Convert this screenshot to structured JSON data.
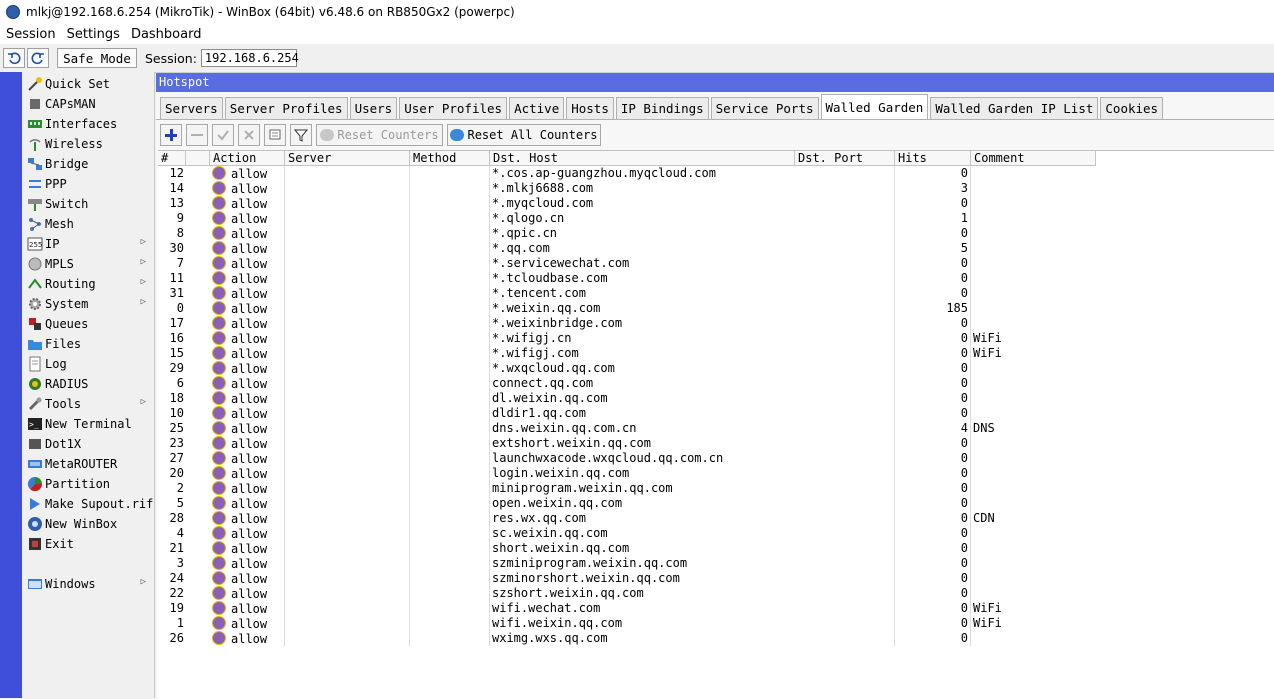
{
  "window": {
    "title": "mlkj@192.168.6.254 (MikroTik) - WinBox (64bit) v6.48.6 on RB850Gx2 (powerpc)"
  },
  "menu": [
    "Session",
    "Settings",
    "Dashboard"
  ],
  "toolbar": {
    "safe_mode": "Safe Mode",
    "session_label": "Session:",
    "session_value": "192.168.6.254"
  },
  "sidebar": {
    "items": [
      {
        "label": "Quick Set",
        "icon": "wand-icon",
        "arrow": false
      },
      {
        "label": "CAPsMAN",
        "icon": "caps-icon",
        "arrow": false
      },
      {
        "label": "Interfaces",
        "icon": "interfaces-icon",
        "arrow": false
      },
      {
        "label": "Wireless",
        "icon": "wireless-icon",
        "arrow": false
      },
      {
        "label": "Bridge",
        "icon": "bridge-icon",
        "arrow": false
      },
      {
        "label": "PPP",
        "icon": "ppp-icon",
        "arrow": false
      },
      {
        "label": "Switch",
        "icon": "switch-icon",
        "arrow": false
      },
      {
        "label": "Mesh",
        "icon": "mesh-icon",
        "arrow": false
      },
      {
        "label": "IP",
        "icon": "ip-icon",
        "arrow": true
      },
      {
        "label": "MPLS",
        "icon": "mpls-icon",
        "arrow": true
      },
      {
        "label": "Routing",
        "icon": "routing-icon",
        "arrow": true
      },
      {
        "label": "System",
        "icon": "system-icon",
        "arrow": true
      },
      {
        "label": "Queues",
        "icon": "queues-icon",
        "arrow": false
      },
      {
        "label": "Files",
        "icon": "files-icon",
        "arrow": false
      },
      {
        "label": "Log",
        "icon": "log-icon",
        "arrow": false
      },
      {
        "label": "RADIUS",
        "icon": "radius-icon",
        "arrow": false
      },
      {
        "label": "Tools",
        "icon": "tools-icon",
        "arrow": true
      },
      {
        "label": "New Terminal",
        "icon": "terminal-icon",
        "arrow": false
      },
      {
        "label": "Dot1X",
        "icon": "dot1x-icon",
        "arrow": false
      },
      {
        "label": "MetaROUTER",
        "icon": "metarouter-icon",
        "arrow": false
      },
      {
        "label": "Partition",
        "icon": "partition-icon",
        "arrow": false
      },
      {
        "label": "Make Supout.rif",
        "icon": "supout-icon",
        "arrow": false
      },
      {
        "label": "New WinBox",
        "icon": "winbox-icon",
        "arrow": false
      },
      {
        "label": "Exit",
        "icon": "exit-icon",
        "arrow": false
      }
    ],
    "windows": {
      "label": "Windows",
      "icon": "windows-icon"
    }
  },
  "hotspot": {
    "title": "Hotspot",
    "tabs": [
      "Servers",
      "Server Profiles",
      "Users",
      "User Profiles",
      "Active",
      "Hosts",
      "IP Bindings",
      "Service Ports",
      "Walled Garden",
      "Walled Garden IP List",
      "Cookies"
    ],
    "active_tab": "Walled Garden",
    "reset_counters": "Reset Counters",
    "reset_all_counters": "Reset All Counters"
  },
  "table": {
    "columns": [
      "#",
      "Action",
      "Server",
      "Method",
      "Dst. Host",
      "Dst. Port",
      "Hits",
      "Comment"
    ],
    "rows": [
      {
        "id": "12",
        "action": "allow",
        "server": "",
        "method": "",
        "host": "*.cos.ap-guangzhou.myqcloud.com",
        "port": "",
        "hits": "0",
        "comment": ""
      },
      {
        "id": "14",
        "action": "allow",
        "server": "",
        "method": "",
        "host": "*.mlkj6688.com",
        "port": "",
        "hits": "3",
        "comment": ""
      },
      {
        "id": "13",
        "action": "allow",
        "server": "",
        "method": "",
        "host": "*.myqcloud.com",
        "port": "",
        "hits": "0",
        "comment": ""
      },
      {
        "id": "9",
        "action": "allow",
        "server": "",
        "method": "",
        "host": "*.qlogo.cn",
        "port": "",
        "hits": "1",
        "comment": ""
      },
      {
        "id": "8",
        "action": "allow",
        "server": "",
        "method": "",
        "host": "*.qpic.cn",
        "port": "",
        "hits": "0",
        "comment": ""
      },
      {
        "id": "30",
        "action": "allow",
        "server": "",
        "method": "",
        "host": "*.qq.com",
        "port": "",
        "hits": "5",
        "comment": ""
      },
      {
        "id": "7",
        "action": "allow",
        "server": "",
        "method": "",
        "host": "*.servicewechat.com",
        "port": "",
        "hits": "0",
        "comment": ""
      },
      {
        "id": "11",
        "action": "allow",
        "server": "",
        "method": "",
        "host": "*.tcloudbase.com",
        "port": "",
        "hits": "0",
        "comment": ""
      },
      {
        "id": "31",
        "action": "allow",
        "server": "",
        "method": "",
        "host": "*.tencent.com",
        "port": "",
        "hits": "0",
        "comment": ""
      },
      {
        "id": "0",
        "action": "allow",
        "server": "",
        "method": "",
        "host": "*.weixin.qq.com",
        "port": "",
        "hits": "185",
        "comment": ""
      },
      {
        "id": "17",
        "action": "allow",
        "server": "",
        "method": "",
        "host": "*.weixinbridge.com",
        "port": "",
        "hits": "0",
        "comment": ""
      },
      {
        "id": "16",
        "action": "allow",
        "server": "",
        "method": "",
        "host": "*.wifigj.cn",
        "port": "",
        "hits": "0",
        "comment": "WiFi"
      },
      {
        "id": "15",
        "action": "allow",
        "server": "",
        "method": "",
        "host": "*.wifigj.com",
        "port": "",
        "hits": "0",
        "comment": "WiFi"
      },
      {
        "id": "29",
        "action": "allow",
        "server": "",
        "method": "",
        "host": "*.wxqcloud.qq.com",
        "port": "",
        "hits": "0",
        "comment": ""
      },
      {
        "id": "6",
        "action": "allow",
        "server": "",
        "method": "",
        "host": "connect.qq.com",
        "port": "",
        "hits": "0",
        "comment": ""
      },
      {
        "id": "18",
        "action": "allow",
        "server": "",
        "method": "",
        "host": "dl.weixin.qq.com",
        "port": "",
        "hits": "0",
        "comment": ""
      },
      {
        "id": "10",
        "action": "allow",
        "server": "",
        "method": "",
        "host": "dldir1.qq.com",
        "port": "",
        "hits": "0",
        "comment": ""
      },
      {
        "id": "25",
        "action": "allow",
        "server": "",
        "method": "",
        "host": "dns.weixin.qq.com.cn",
        "port": "",
        "hits": "4",
        "comment": "DNS"
      },
      {
        "id": "23",
        "action": "allow",
        "server": "",
        "method": "",
        "host": "extshort.weixin.qq.com",
        "port": "",
        "hits": "0",
        "comment": ""
      },
      {
        "id": "27",
        "action": "allow",
        "server": "",
        "method": "",
        "host": "launchwxacode.wxqcloud.qq.com.cn",
        "port": "",
        "hits": "0",
        "comment": ""
      },
      {
        "id": "20",
        "action": "allow",
        "server": "",
        "method": "",
        "host": "login.weixin.qq.com",
        "port": "",
        "hits": "0",
        "comment": ""
      },
      {
        "id": "2",
        "action": "allow",
        "server": "",
        "method": "",
        "host": "miniprogram.weixin.qq.com",
        "port": "",
        "hits": "0",
        "comment": ""
      },
      {
        "id": "5",
        "action": "allow",
        "server": "",
        "method": "",
        "host": "open.weixin.qq.com",
        "port": "",
        "hits": "0",
        "comment": ""
      },
      {
        "id": "28",
        "action": "allow",
        "server": "",
        "method": "",
        "host": "res.wx.qq.com",
        "port": "",
        "hits": "0",
        "comment": "CDN"
      },
      {
        "id": "4",
        "action": "allow",
        "server": "",
        "method": "",
        "host": "sc.weixin.qq.com",
        "port": "",
        "hits": "0",
        "comment": ""
      },
      {
        "id": "21",
        "action": "allow",
        "server": "",
        "method": "",
        "host": "short.weixin.qq.com",
        "port": "",
        "hits": "0",
        "comment": ""
      },
      {
        "id": "3",
        "action": "allow",
        "server": "",
        "method": "",
        "host": "szminiprogram.weixin.qq.com",
        "port": "",
        "hits": "0",
        "comment": ""
      },
      {
        "id": "24",
        "action": "allow",
        "server": "",
        "method": "",
        "host": "szminorshort.weixin.qq.com",
        "port": "",
        "hits": "0",
        "comment": ""
      },
      {
        "id": "22",
        "action": "allow",
        "server": "",
        "method": "",
        "host": "szshort.weixin.qq.com",
        "port": "",
        "hits": "0",
        "comment": ""
      },
      {
        "id": "19",
        "action": "allow",
        "server": "",
        "method": "",
        "host": "wifi.wechat.com",
        "port": "",
        "hits": "0",
        "comment": "WiFi"
      },
      {
        "id": "1",
        "action": "allow",
        "server": "",
        "method": "",
        "host": "wifi.weixin.qq.com",
        "port": "",
        "hits": "0",
        "comment": "WiFi"
      },
      {
        "id": "26",
        "action": "allow",
        "server": "",
        "method": "",
        "host": "wximg.wxs.qq.com",
        "port": "",
        "hits": "0",
        "comment": ""
      }
    ]
  }
}
